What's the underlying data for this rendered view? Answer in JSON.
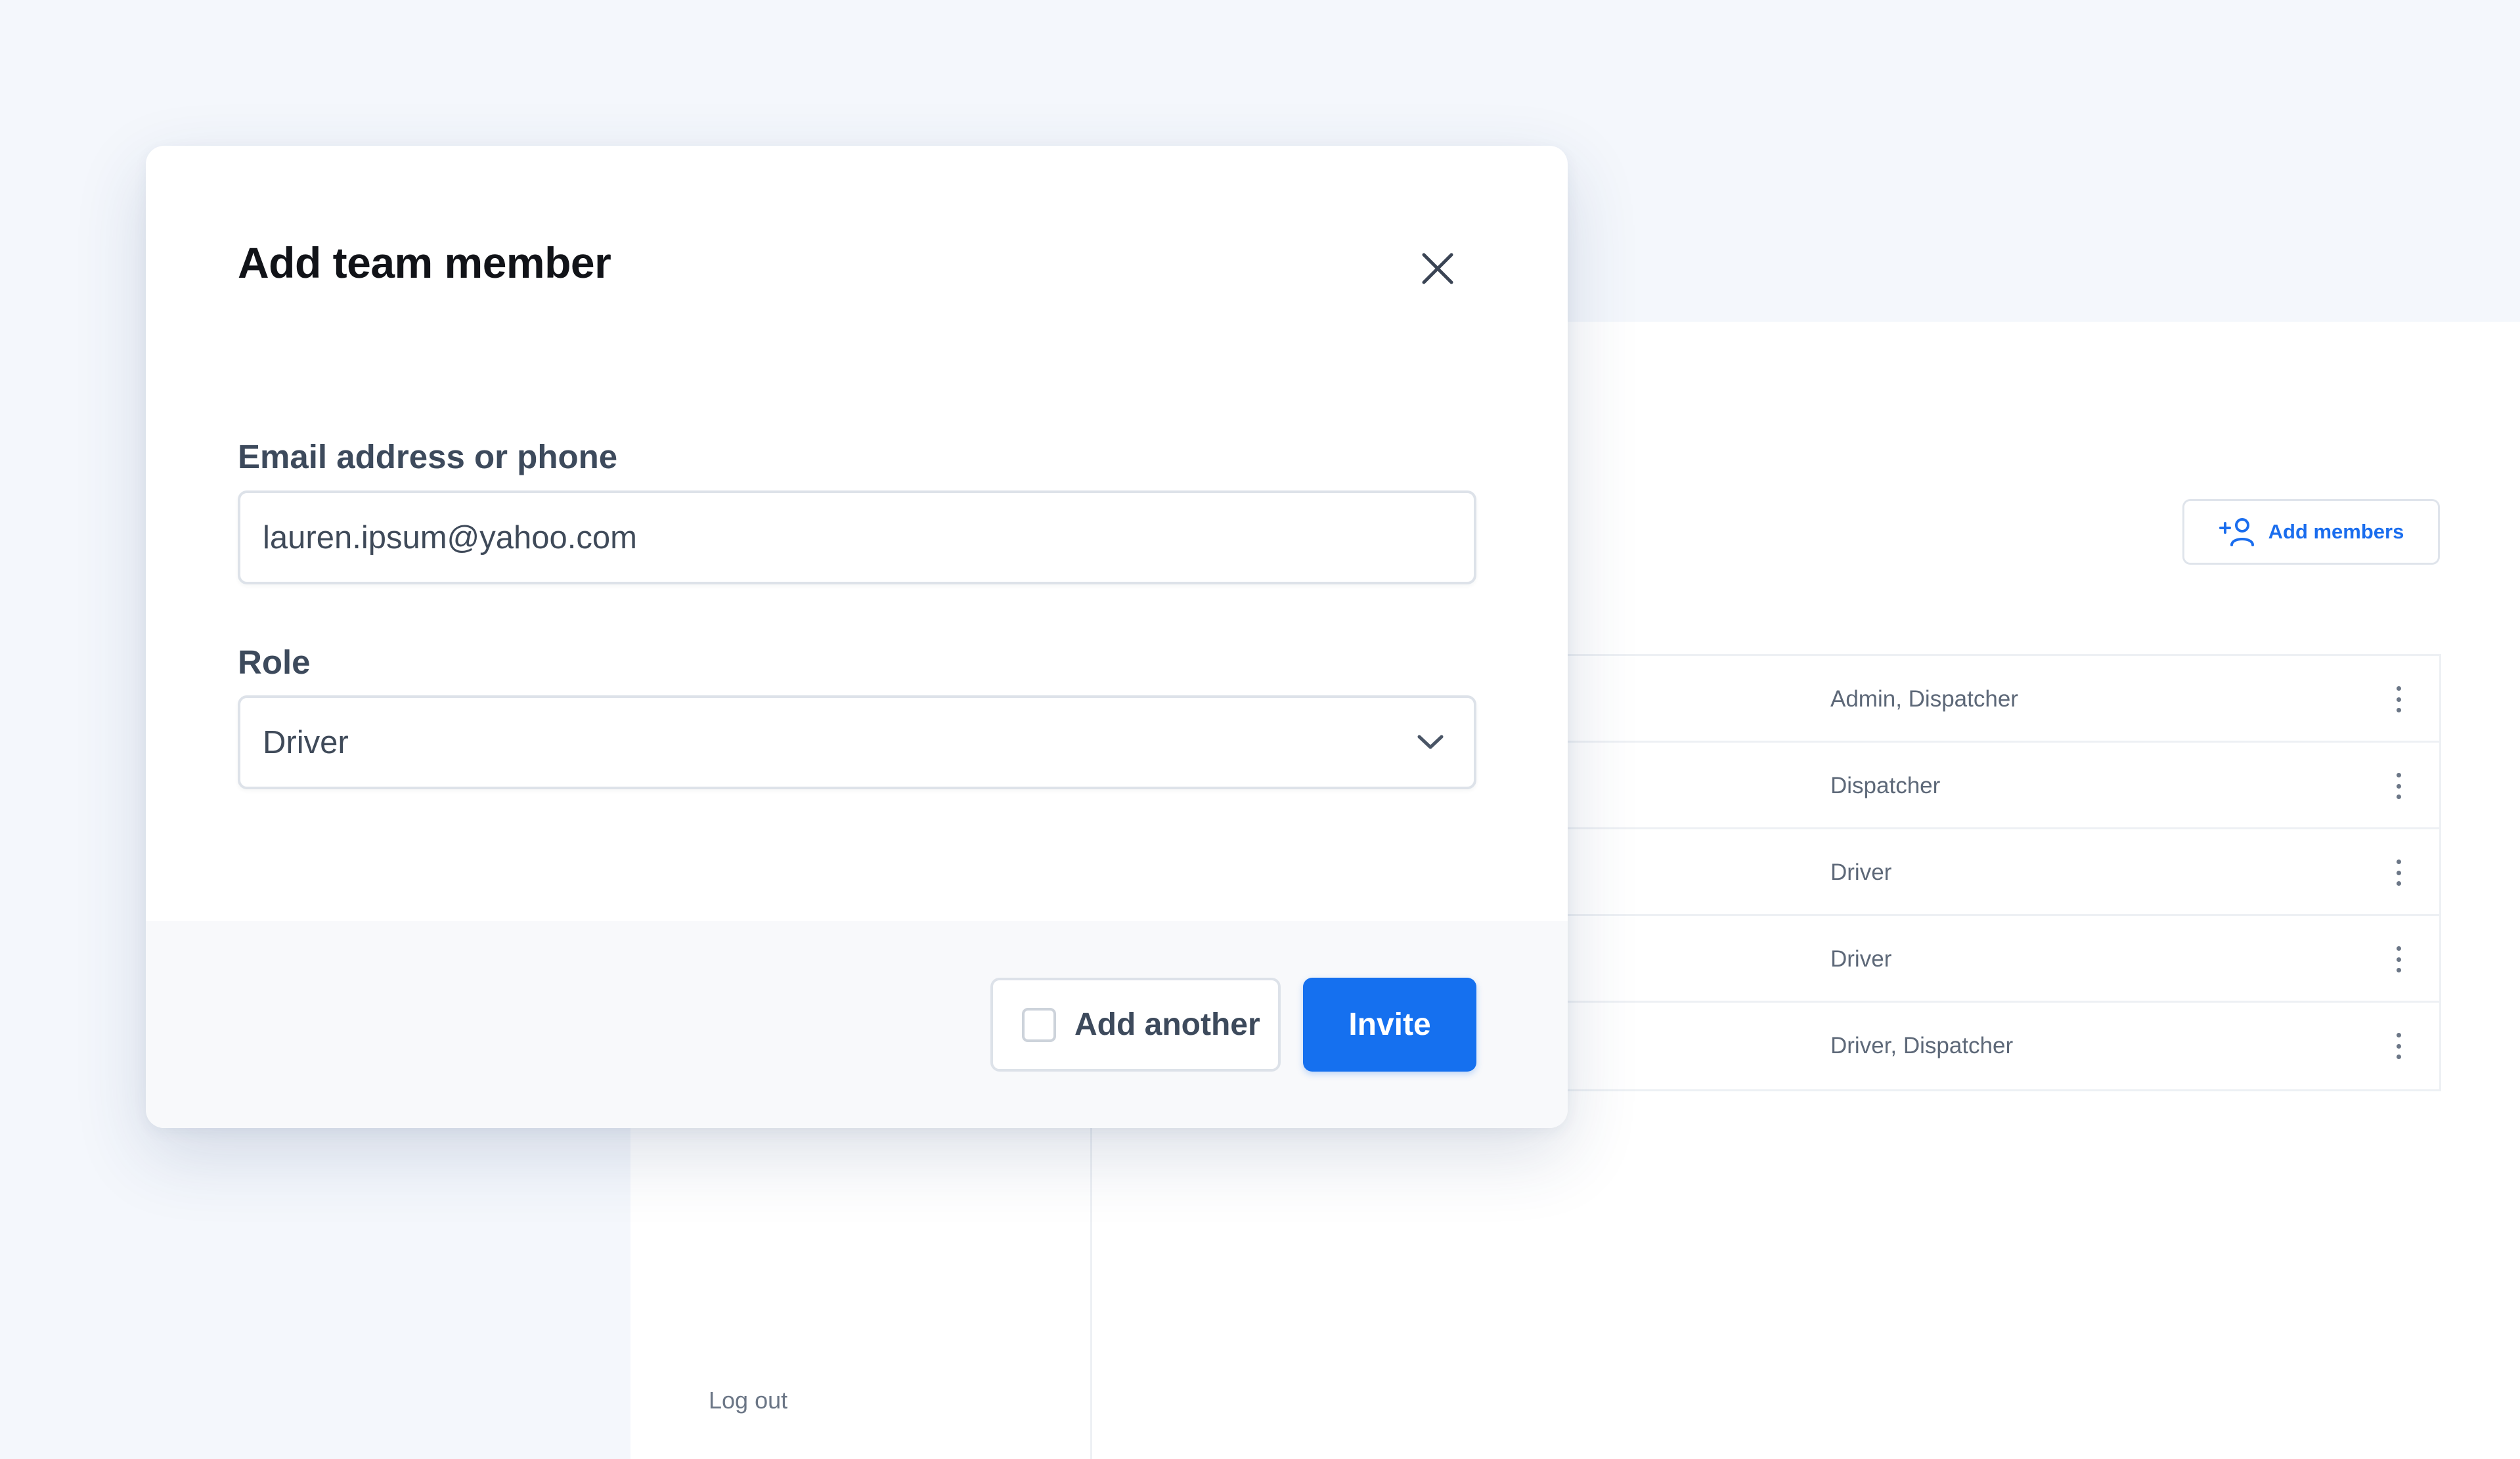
{
  "background": {
    "logout_label": "Log out",
    "add_members_label": "Add members",
    "members_rows": [
      {
        "role": "Admin, Dispatcher"
      },
      {
        "role": "Dispatcher"
      },
      {
        "role": "Driver"
      },
      {
        "role": "Driver"
      },
      {
        "role": "Driver, Dispatcher"
      }
    ]
  },
  "modal": {
    "title": "Add team member",
    "close_icon": "close-icon",
    "email": {
      "label": "Email address or phone",
      "value": "lauren.ipsum@yahoo.com"
    },
    "role": {
      "label": "Role",
      "selected": "Driver"
    },
    "footer": {
      "add_another_label": "Add another",
      "add_another_checked": false,
      "invite_label": "Invite"
    }
  },
  "colors": {
    "primary": "#1570ef",
    "page_background": "#f4f7fc"
  }
}
